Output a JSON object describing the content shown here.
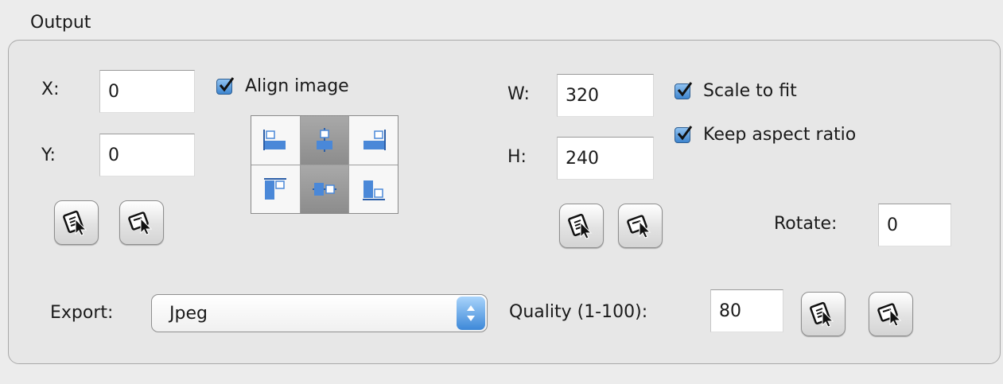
{
  "group": {
    "title": "Output"
  },
  "position": {
    "x_label": "X:",
    "x_value": "0",
    "y_label": "Y:",
    "y_value": "0"
  },
  "align": {
    "checkbox_label": "Align image",
    "checked": true,
    "selected_cell": "top-center"
  },
  "size": {
    "w_label": "W:",
    "w_value": "320",
    "h_label": "H:",
    "h_value": "240",
    "scale_label": "Scale to fit",
    "scale_checked": true,
    "aspect_label": "Keep aspect ratio",
    "aspect_checked": true
  },
  "rotate": {
    "label": "Rotate:",
    "value": "0"
  },
  "export": {
    "label": "Export:",
    "selected": "Jpeg"
  },
  "quality": {
    "label": "Quality (1-100):",
    "value": "80"
  },
  "colors": {
    "checkbox_accent": "#3e85cf",
    "align_icon": "#4a88d8"
  }
}
